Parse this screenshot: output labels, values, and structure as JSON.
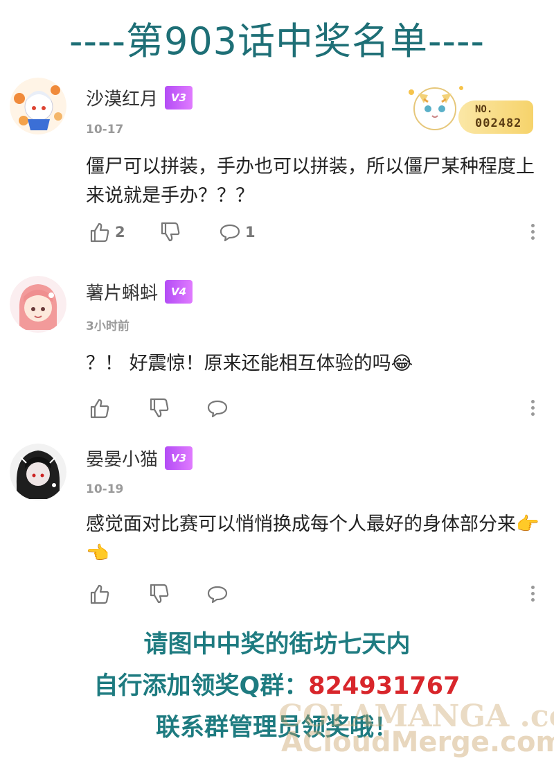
{
  "title": "----第903话中奖名单----",
  "comments": [
    {
      "user": "沙漠红月",
      "level": "V3",
      "date": "10-17",
      "text": "僵尸可以拼装，手办也可以拼装，所以僵尸某种程度上来说就是手办？？？",
      "likes": "2",
      "replies": "1",
      "badge": {
        "prefix": "NO.",
        "number": "002482"
      }
    },
    {
      "user": "薯片蝌蚪",
      "level": "V4",
      "date": "3小时前",
      "text": "？！ 好震惊！原来还能相互体验的吗😂",
      "likes": "",
      "replies": ""
    },
    {
      "user": "晏晏小猫",
      "level": "V3",
      "date": "10-19",
      "text": "感觉面对比赛可以悄悄换成每个人最好的身体部分来👉👈",
      "likes": "",
      "replies": ""
    }
  ],
  "footer": {
    "line1": "请图中中奖的街坊七天内",
    "line2_prefix": "自行添加领奖Q群：",
    "qq_number": "824931767",
    "line3": "联系群管理员领奖哦！"
  },
  "watermark": {
    "line1": "COLAMANGA .com",
    "line2": "ACloudMerge.com"
  },
  "colors": {
    "title": "#1e6f76",
    "footer": "#1e7b80",
    "qq": "#d8262b",
    "level_badge": "#c05cf8"
  }
}
